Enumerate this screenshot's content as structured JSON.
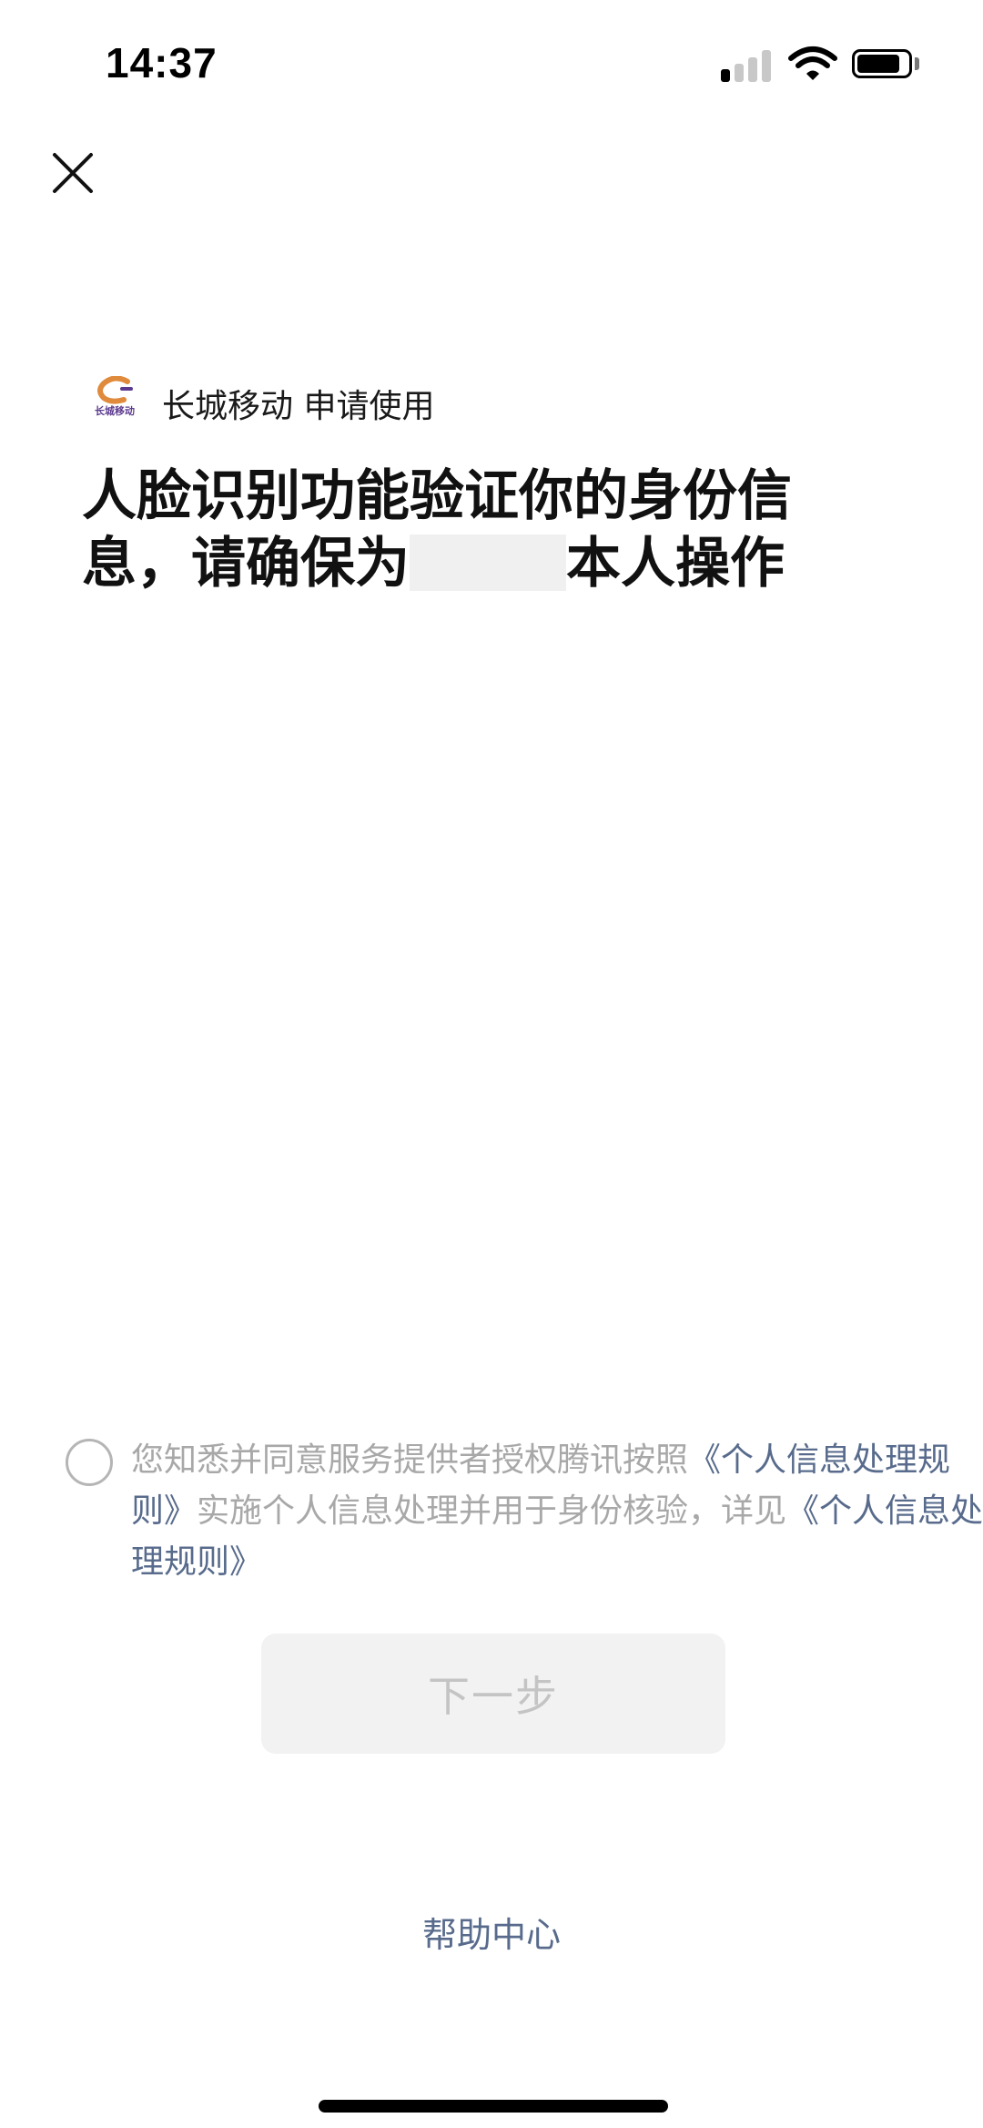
{
  "status_bar": {
    "time": "14:37",
    "signal_bars_active": 1,
    "signal_bars_total": 4,
    "wifi": "wifi-icon",
    "battery": "battery-icon"
  },
  "nav": {
    "close_icon": "close-icon"
  },
  "app": {
    "logo_text": "长城移动",
    "name": "长城移动",
    "request_suffix": "申请使用"
  },
  "title": {
    "line1": "人脸识别功能验证你的身份信",
    "line2_before": "息，请确保为",
    "line2_after": "本人操作"
  },
  "agreement": {
    "text_before": "您知悉并同意服务提供者授权腾讯按照",
    "link1": "《个人信息处理规则》",
    "text_middle": "实施个人信息处理并用于身份核验，详见",
    "link2": "《个人信息处理规则》",
    "checked": false
  },
  "actions": {
    "next_label": "下一步",
    "help_label": "帮助中心"
  },
  "colors": {
    "link": "#586b8c",
    "muted_text": "#a8a8a8",
    "disabled_button_bg": "#f2f2f2",
    "disabled_button_text": "#c4c4c4",
    "logo_accent": "#e08a3c",
    "logo_purple": "#5b3a8e"
  }
}
